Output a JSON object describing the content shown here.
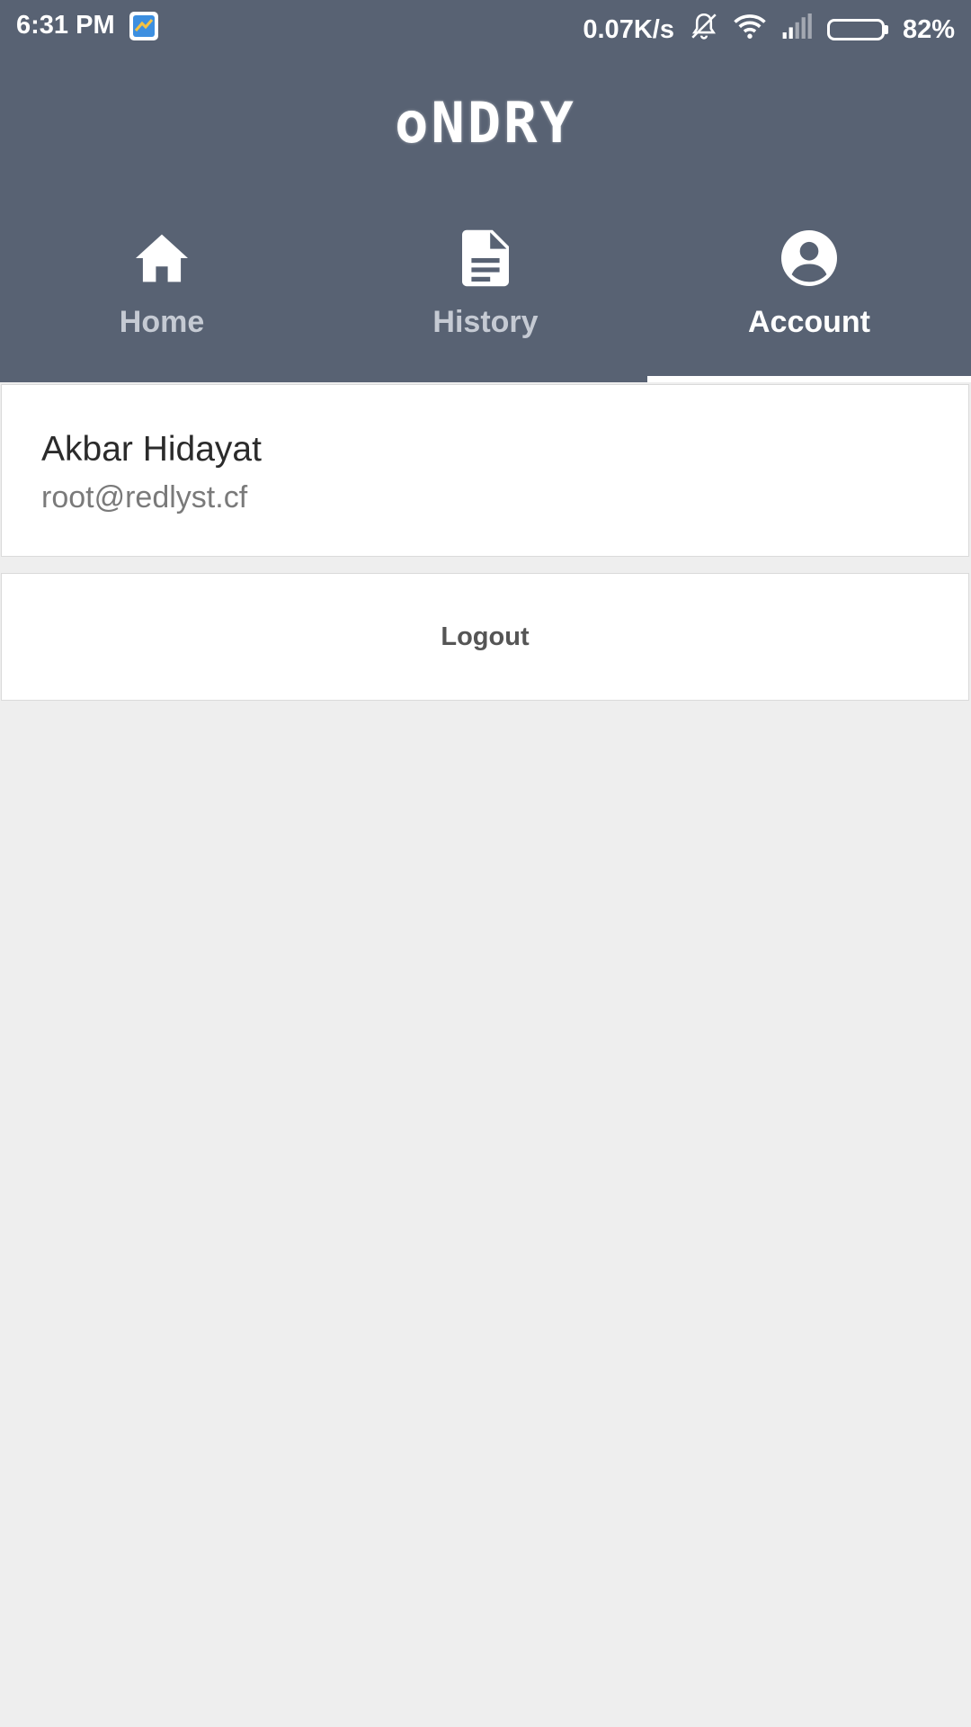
{
  "status_bar": {
    "time": "6:31 PM",
    "network_speed": "0.07K/s",
    "battery_percent": "82%",
    "battery_level": 0.82,
    "icons": [
      "app-notification-icon",
      "silent-mode-icon",
      "wifi-icon",
      "cellular-signal-icon",
      "battery-icon"
    ]
  },
  "header": {
    "logo": "oNDRY",
    "background_color": "#586273"
  },
  "tabs": [
    {
      "label": "Home",
      "icon": "home-icon",
      "active": false
    },
    {
      "label": "History",
      "icon": "document-icon",
      "active": false
    },
    {
      "label": "Account",
      "icon": "account-circle-icon",
      "active": true
    }
  ],
  "account": {
    "name": "Akbar Hidayat",
    "email": "root@redlyst.cf"
  },
  "actions": {
    "logout_label": "Logout"
  }
}
